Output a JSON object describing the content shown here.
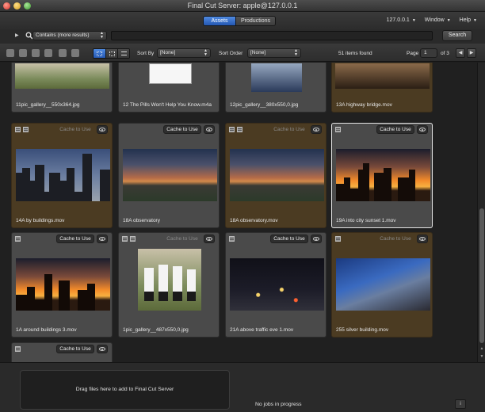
{
  "window": {
    "title": "Final Cut Server: apple@127.0.0.1"
  },
  "tabs": [
    {
      "label": "Assets",
      "active": true
    },
    {
      "label": "Productions",
      "active": false
    }
  ],
  "menus": [
    {
      "label": "127.0.0.1"
    },
    {
      "label": "Window"
    },
    {
      "label": "Help"
    }
  ],
  "search": {
    "scope": "Contains (more results)",
    "query": "",
    "button_label": "Search"
  },
  "toolbar": {
    "sort_by_label": "Sort By",
    "sort_by_value": "[None]",
    "sort_order_label": "Sort Order",
    "sort_order_value": "[None]",
    "items_found": "51 items found",
    "page_label": "Page",
    "page_value": "1",
    "page_of": "of 3"
  },
  "cache_label": "Cache to Use",
  "assets": [
    {
      "name": "11pic_gallery__550x364.jpg"
    },
    {
      "name": "12 The Pills Won't Help You Know.m4a"
    },
    {
      "name": "12pic_gallery__380x550,0.jpg"
    },
    {
      "name": "13A highway bridge.mov"
    },
    {
      "name": "14A by buildings.mov"
    },
    {
      "name": "18A observatory"
    },
    {
      "name": "18A observatory.mov"
    },
    {
      "name": "19A into city sunset 1.mov"
    },
    {
      "name": "1A around buildings 3.mov"
    },
    {
      "name": "1pic_gallery__487x550,0.jpg"
    },
    {
      "name": "21A above traffic eve 1.mov"
    },
    {
      "name": "255 silver building.mov"
    }
  ],
  "dropzone": {
    "text": "Drag files here to add to Final Cut Server"
  },
  "status": {
    "jobs": "No jobs in progress",
    "info_label": "i"
  }
}
